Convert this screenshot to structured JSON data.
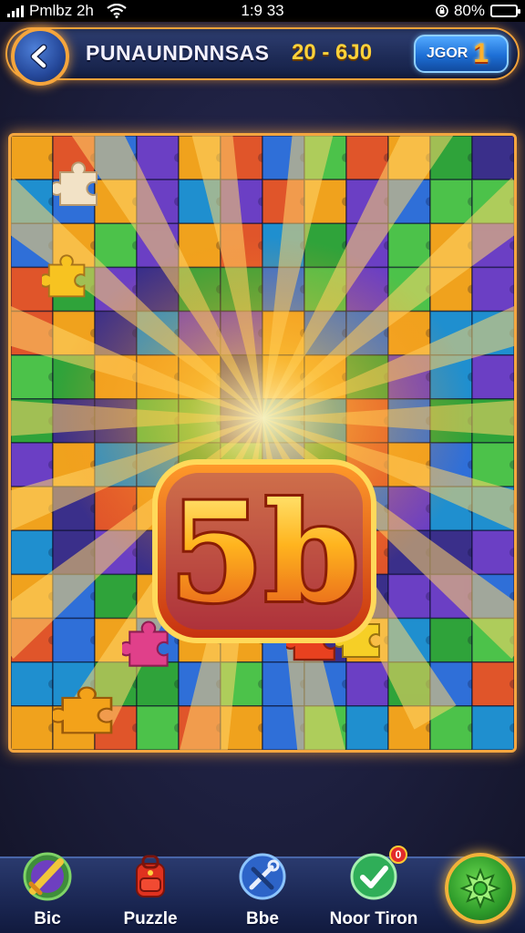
{
  "status_bar": {
    "carrier": "Pmlbz 2h",
    "time": "1:9 33",
    "battery": "80%",
    "battery_level": 0.8
  },
  "header": {
    "title": "PUNAUNDNNSAS",
    "level_range": "20 - 6J0",
    "score_label": "JGOR",
    "score_value": "1",
    "back_icon": "back-arrow-icon"
  },
  "board": {
    "center_number": "5b",
    "piece_colors": [
      "#2f6fd8",
      "#6b3fc4",
      "#2fa33a",
      "#f0a21d",
      "#e0552a",
      "#1f8fcf",
      "#3a2f8a",
      "#4cc24a"
    ],
    "accent": "#f4a640"
  },
  "bottom_nav": {
    "items": [
      {
        "label": "Bic",
        "icon": "sword-icon"
      },
      {
        "label": "Puzzle",
        "icon": "backpack-icon"
      },
      {
        "label": "Bbe",
        "icon": "tools-icon"
      },
      {
        "label": "Noor Tiron",
        "icon": "checkmark-icon",
        "badge": "0"
      }
    ],
    "play_icon": "puzzle-star-icon"
  }
}
